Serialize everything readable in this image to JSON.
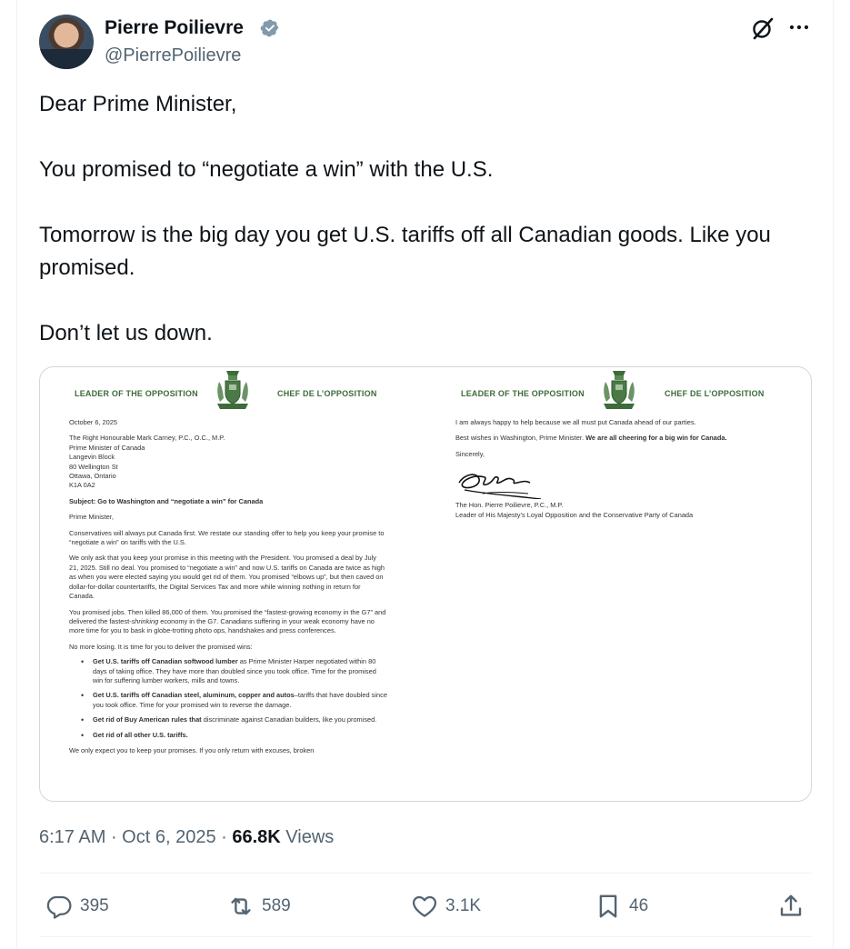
{
  "author": {
    "name": "Pierre Poilievre",
    "handle": "@PierrePoilievre",
    "verified_color": "#829aab"
  },
  "header_icons": [
    "grok-icon",
    "more-icon"
  ],
  "tweet": {
    "paragraphs": [
      "Dear Prime Minister,",
      "You promised to “negotiate a win” with the U.S.",
      "Tomorrow is the big day you get U.S. tariffs off all Canadian goods. Like you promised.",
      "Don’t let us down."
    ]
  },
  "letter_page1": {
    "header_left": "LEADER OF THE OPPOSITION",
    "header_right": "CHEF DE L’OPPOSITION",
    "date": "October 6, 2025",
    "address": [
      "The Right Honourable Mark Carney, P.C., O.C., M.P.",
      "Prime Minister of Canada",
      "Langevin Block",
      "80 Wellington St",
      "Ottawa, Ontario",
      "K1A 0A2"
    ],
    "subject": "Subject: Go to Washington and “negotiate a win” for Canada",
    "salutation": "Prime Minister,",
    "p1": "Conservatives will always put Canada first. We restate our standing offer to help you keep your promise to “negotiate a win” on tariffs with the U.S.",
    "p2": "We only ask that you keep your promise in this meeting with the President. You promised a deal by July 21, 2025. Still no deal. You promised to “negotiate a win” and now U.S. tariffs on Canada are twice as high as when you were elected saying you would get rid of them. You promised “elbows up”, but then caved on dollar-for-dollar countertariffs, the Digital Services Tax and more while winning nothing in return for Canada.",
    "p3_a": "You promised jobs. Then killed 86,000 of them. You promised the “fastest-growing economy in the G7” and delivered the fastest-",
    "p3_em": "shrinking",
    "p3_b": " economy in the G7. Canadians suffering in your weak economy have no more time for you to bask in globe-trotting photo ops, handshakes and press conferences.",
    "p4": "No more losing. It is time for you to deliver the promised wins:",
    "bullets": [
      {
        "bold": "Get U.S. tariffs off Canadian softwood lumber",
        "rest": " as Prime Minister Harper negotiated within 80 days of taking office. They have more than doubled since you took office. Time for the promised win for suffering lumber workers, mills and towns."
      },
      {
        "bold": "Get U.S. tariffs off Canadian steel, aluminum, copper and autos",
        "rest": "–tariffs that have doubled since you took office. Time for your promised win to reverse the damage."
      },
      {
        "bold": "Get rid of Buy American rules that",
        "rest": " discriminate against Canadian builders, like you promised."
      },
      {
        "bold": "Get rid of all other U.S. tariffs.",
        "rest": ""
      }
    ],
    "p5": "We only expect you to keep your promises. If you only return with excuses, broken"
  },
  "letter_page2": {
    "header_left": "LEADER OF THE OPPOSITION",
    "header_right": "CHEF DE L’OPPOSITION",
    "p1": "I am always happy to help because we all must put Canada ahead of our parties.",
    "p2_a": "Best wishes in Washington, Prime Minister. ",
    "p2_b": "We are all cheering for a big win for Canada.",
    "closing": "Sincerely,",
    "signer": "The Hon. Pierre Poilievre, P.C., M.P.",
    "signer_title": "Leader of His Majesty’s Loyal Opposition and the Conservative Party of Canada"
  },
  "meta": {
    "time": "6:17 AM",
    "date": "Oct 6, 2025",
    "views_count": "66.8K",
    "views_label": "Views"
  },
  "actions": {
    "replies": "395",
    "reposts": "589",
    "likes": "3.1K",
    "bookmarks": "46"
  },
  "colors": {
    "text": "#0f1419",
    "secondary": "#536471",
    "letterhead_green": "#3d6b3a",
    "border": "#cfd9de"
  }
}
